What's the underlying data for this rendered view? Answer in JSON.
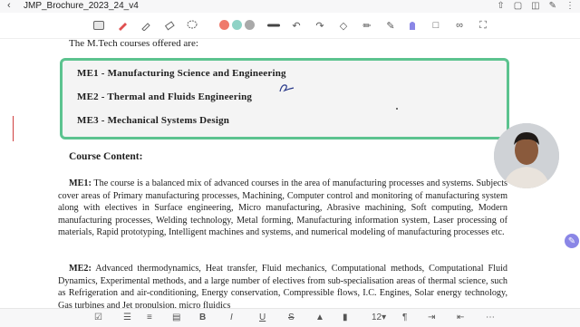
{
  "header": {
    "back_icon": "chevron-left-icon",
    "title": "JMP_Brochure_2023_24_v4",
    "actions": [
      "share-icon",
      "book-icon",
      "columns-icon",
      "pen-icon",
      "more-icon"
    ]
  },
  "toolbar": {
    "tools": [
      "page-view-icon",
      "pen-icon",
      "highlighter-icon",
      "eraser-icon",
      "lasso-icon"
    ],
    "colors": [
      "#ef7a6c",
      "#8fd3c6",
      "#a9a9a9"
    ],
    "tools_right": [
      "line-thickness-icon",
      "undo-icon",
      "redo-icon",
      "shapes-icon",
      "text-icon",
      "marker-icon",
      "image-icon",
      "sticky-icon",
      "link-icon",
      "fullscreen-icon"
    ]
  },
  "document": {
    "intro": "The M.Tech courses offered are:",
    "courses": [
      "ME1 - Manufacturing Science and Engineering",
      "ME2 - Thermal and Fluids Engineering",
      "ME3 - Mechanical Systems Design"
    ],
    "section_heading": "Course Content:",
    "me1_label": "ME1:",
    "me1_text": "The course is a balanced mix of advanced courses in the area of manufacturing processes and systems. Subjects cover areas of Primary manufacturing processes, Machining, Computer control and monitoring of manufacturing system along with electives in Surface engineering, Micro manufacturing, Abrasive machining, Soft computing, Modern manufacturing processes, Welding technology, Metal forming, Manufacturing information system, Laser processing of materials, Rapid prototyping, Intelligent machines and systems, and numerical modeling of manufacturing processes etc.",
    "me2_label": "ME2:",
    "me2_text": "Advanced thermodynamics, Heat transfer, Fluid mechanics, Computational methods, Computational Fluid Dynamics, Experimental methods, and a large number of electives from sub-specialisation areas of thermal science, such as Refrigeration and air-conditioning, Energy conservation, Compressible flows, I.C. Engines, Solar energy technology, Gas turbines and Jet propulsion, micro fluidics"
  },
  "bottom_toolbar": {
    "items": [
      "checkbox-icon",
      "bullets-icon",
      "numbered-icon",
      "align-icon",
      "indent-icon"
    ],
    "bold": "B",
    "italic": "I",
    "underline": "U",
    "strike": "S",
    "font_size": "12",
    "font_size_caret": "▾"
  },
  "colors": {
    "accent_border": "#5cc38f",
    "box_bg": "#f4f4f4"
  }
}
